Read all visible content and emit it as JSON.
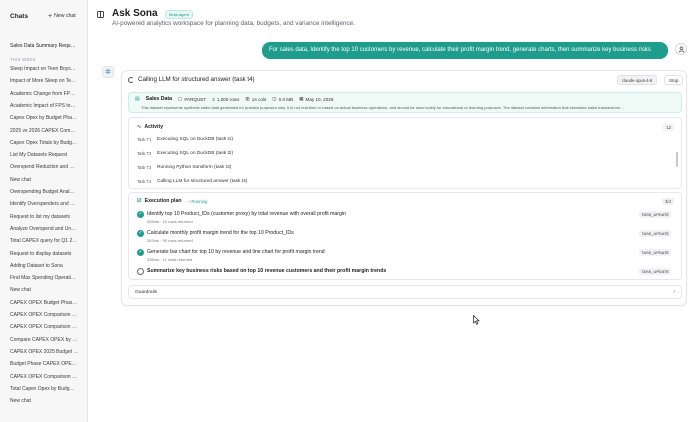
{
  "sidebar": {
    "title": "Chats",
    "new_chat": "New chat",
    "items": [
      {
        "label": "Sales Data Summary Requ…",
        "section": "today"
      },
      {
        "label": "Sleep Impact on Teen Boys…"
      },
      {
        "label": "Impact of More Sleep on Te…"
      },
      {
        "label": "Academic Change from FP…"
      },
      {
        "label": "Academic Impact of FPS to…"
      },
      {
        "label": "Capex Opex by Budget Pha…"
      },
      {
        "label": "2025 vs 2026 CAPEX Com…"
      },
      {
        "label": "Capex Opex Totals by Budg…"
      },
      {
        "label": "List My Datasets Request"
      },
      {
        "label": "Overspend Reduction and …"
      },
      {
        "label": "New chat"
      },
      {
        "label": "Overspending Budget Anal…"
      },
      {
        "label": "Identify Overspenders and …"
      },
      {
        "label": "Request to list my datasets"
      },
      {
        "label": "Analyze Overspend and Un…"
      },
      {
        "label": "Total CAPEX query for Q1 2…"
      },
      {
        "label": "Request to display datasets"
      },
      {
        "label": "Adding Dataset to Sona"
      },
      {
        "label": "Find Max Spending Operati…"
      },
      {
        "label": "New chat"
      },
      {
        "label": "CAPEX OPEX Budget Phas…"
      },
      {
        "label": "CAPEX OPEX Comparison …"
      },
      {
        "label": "CAPEX OPEX Comparison …"
      },
      {
        "label": "Compare CAPEX OPEX by …"
      },
      {
        "label": "CAPEX OPEX 2025 Budget …"
      },
      {
        "label": "Budget Phase CAPEX OPE…"
      },
      {
        "label": "CAPEX OPEX Comparison …"
      },
      {
        "label": "Total Capex Opex by Budg…"
      },
      {
        "label": "New chat"
      }
    ],
    "section_label": "THIS WEEK"
  },
  "header": {
    "title": "Ask Sona",
    "badge": "Multi-agent",
    "subtitle": "AI-powered analytics workspace for planning data, budgets, and variance intelligence."
  },
  "user_message": "For sales data, Identify the top 10 customers by revenue, calculate their profit margin trend, generate charts, then summarize key business risks",
  "assistant": {
    "status": "Calling LLM for structured answer (task t4)",
    "model": "claude-opus-4-6",
    "stop_label": "Stop",
    "dataset": {
      "name": "Sales Data",
      "format": "PARQUET",
      "rows": "1,000 rows",
      "cols": "14 cols",
      "size": "0.0 MB",
      "date": "May 10, 2026",
      "description": "This dataset represents synthetic sales data generated for practice purposes only. It is not real-time or based on actual business operations, and should be used solely for educational or learning purposes. The dataset contains information that simulates sales transactions…"
    },
    "activity": {
      "label": "Activity",
      "count": "12",
      "lines": [
        {
          "tag": "Task T1",
          "text": "Executing SQL on DuckDB (task t1)"
        },
        {
          "tag": "Task T2",
          "text": "Executing SQL on DuckDB (task t2)"
        },
        {
          "tag": "Task T3",
          "text": "Running Python transform (task t3)"
        },
        {
          "tag": "Task T4",
          "text": "Calling LLM for structured answer (task t4)"
        }
      ]
    },
    "plan": {
      "label": "Execution plan",
      "status": "Running",
      "count": "3/4",
      "tasks": [
        {
          "text": "Identify top 10 Product_IDs (customer proxy) by total revenue with overall profit margin",
          "meta": "255ms · 10 rows returned",
          "tag": "TASK_UPDATE",
          "done": true
        },
        {
          "text": "Calculate monthly profit margin trend for the top 10 Product_IDs",
          "meta": "262ms · 90 rows returned",
          "tag": "TASK_UPDATE",
          "done": true
        },
        {
          "text": "Generate bar chart for top 10 by revenue and line chart for profit margin trend",
          "meta": "335ms · 11 rows returned",
          "tag": "TASK_UPDATE",
          "done": true
        },
        {
          "text": "Summarize key business risks based on top 10 revenue customers and their profit margin trends",
          "meta": "",
          "tag": "TASK_UPDATE",
          "done": false
        }
      ]
    },
    "guardrails": "Guardrails"
  },
  "colors": {
    "accent": "#1e9d8c",
    "dataset_bg": "#effaf7"
  }
}
